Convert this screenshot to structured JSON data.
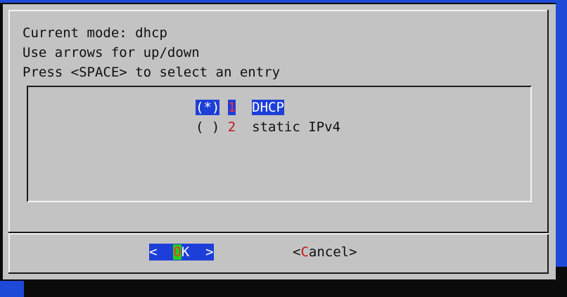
{
  "dialog": {
    "info_lines": [
      "Current mode: dhcp",
      "Use arrows for up/down",
      "Press <SPACE> to select an entry"
    ]
  },
  "options": [
    {
      "marker": "(*)",
      "number": "1",
      "label": "DHCP",
      "selected": true
    },
    {
      "marker": "( )",
      "number": "2",
      "label": "static IPv4",
      "selected": false
    }
  ],
  "buttons": {
    "ok": {
      "left": "<",
      "hotkey": "O",
      "rest": "K",
      "right": ">"
    },
    "cancel": {
      "open": "<",
      "hotkey": "C",
      "rest": "ancel",
      "close": ">"
    }
  },
  "colors": {
    "dialog_bg": "#c3c3c3",
    "selection_bg": "#1d3fd8",
    "hotkey_red": "#c41818",
    "hotkey_green_bg": "#22d11f",
    "screen_blue": "#1d4ad6"
  }
}
